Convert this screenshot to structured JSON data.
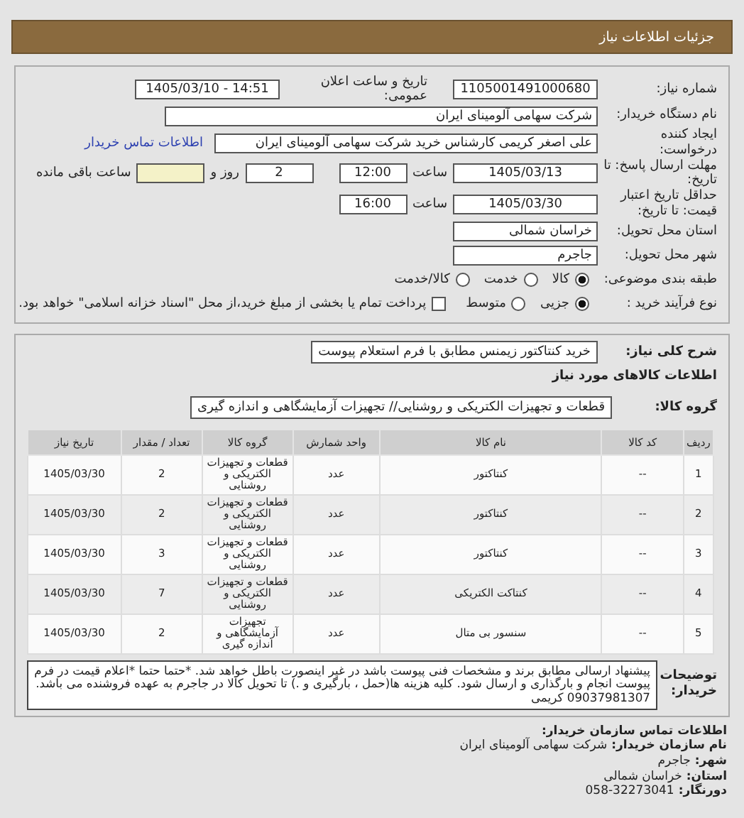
{
  "title": "جزئیات اطلاعات نیاز",
  "need_number": {
    "label": "شماره نیاز:",
    "value": "1105001491000680"
  },
  "announce": {
    "label": "تاریخ و ساعت اعلان عمومی:",
    "value": "1405/03/10 - 14:51"
  },
  "buyer_org": {
    "label": "نام دستگاه خریدار:",
    "value": "شرکت سهامی آلومینای ایران"
  },
  "creator": {
    "label": "ایجاد کننده درخواست:",
    "value": "علی اصغر کریمی کارشناس خرید شرکت سهامی آلومینای ایران",
    "link": "اطلاعات تماس خریدار"
  },
  "deadline": {
    "label": "مهلت ارسال پاسخ: تا تاریخ:",
    "date": "1405/03/13",
    "time_label": "ساعت",
    "time": "12:00",
    "days": "2",
    "days_label": "روز و",
    "remaining_label": "ساعت باقی مانده"
  },
  "validity": {
    "label": "حداقل تاریخ اعتبار قیمت: تا تاریخ:",
    "date": "1405/03/30",
    "time_label": "ساعت",
    "time": "16:00"
  },
  "province": {
    "label": "استان محل تحویل:",
    "value": "خراسان شمالی"
  },
  "city": {
    "label": "شهر محل تحویل:",
    "value": "جاجرم"
  },
  "category": {
    "label": "طبقه بندی موضوعی:",
    "options": [
      {
        "label": "کالا",
        "selected": true
      },
      {
        "label": "خدمت",
        "selected": false
      },
      {
        "label": "کالا/خدمت",
        "selected": false
      }
    ]
  },
  "process": {
    "label": "نوع فرآیند خرید :",
    "options": [
      {
        "label": "جزیی",
        "selected": true
      },
      {
        "label": "متوسط",
        "selected": false
      }
    ],
    "payment": {
      "checked": false,
      "label": "پرداخت تمام یا بخشی از مبلغ خرید،از محل \"اسناد خزانه اسلامی\" خواهد بود."
    }
  },
  "description": {
    "label": "شرح کلی نیاز:",
    "value": "خرید کنتاکتور زیمنس مطابق با فرم استعلام پیوست"
  },
  "goods_heading": "اطلاعات کالاهای مورد نیاز",
  "goods_group": {
    "label": "گروه کالا:",
    "value": "قطعات و تجهیزات الکتریکی و روشنایی// تجهیزات آزمایشگاهی و اندازه گیری"
  },
  "table": {
    "columns": [
      "ردیف",
      "کد کالا",
      "نام کالا",
      "واحد شمارش",
      "گروه کالا",
      "تعداد / مقدار",
      "تاریخ نیاز"
    ],
    "rows": [
      [
        "1",
        "--",
        "کنتاکتور",
        "عدد",
        "قطعات و تجهیزات الکتریکی و روشنایی",
        "2",
        "1405/03/30"
      ],
      [
        "2",
        "--",
        "کنتاکتور",
        "عدد",
        "قطعات و تجهیزات الکتریکی و روشنایی",
        "2",
        "1405/03/30"
      ],
      [
        "3",
        "--",
        "کنتاکتور",
        "عدد",
        "قطعات و تجهیزات الکتریکی و روشنایی",
        "3",
        "1405/03/30"
      ],
      [
        "4",
        "--",
        "کنتاکت الکتریکی",
        "عدد",
        "قطعات و تجهیزات الکتریکی و روشنایی",
        "7",
        "1405/03/30"
      ],
      [
        "5",
        "--",
        "سنسور بی متال",
        "عدد",
        "تجهیزات آزمایشگاهی و اندازه گیری",
        "2",
        "1405/03/30"
      ]
    ]
  },
  "buyer_notes": {
    "label": "توضیحات خریدار:",
    "value": "پیشنهاد ارسالی مطابق برند و مشخصات فنی پیوست باشد در غیر اینصورت باطل خواهد شد. *حتما حتما *اعلام قیمت در فرم پیوست انجام و بارگذاری و ارسال شود. کلیه هزینه ها(حمل ، بارگیری و .) تا تحویل کالا در جاجرم به عهده فروشنده می باشد. 09037981307 کریمی"
  },
  "contact": {
    "heading": "اطلاعات تماس سازمان خریدار:",
    "items": [
      {
        "label": "نام سازمان خریدار:",
        "value": "شرکت سهامی آلومینای ایران"
      },
      {
        "label": "شهر:",
        "value": "جاجرم"
      },
      {
        "label": "استان:",
        "value": "خراسان شمالی"
      },
      {
        "label": "دورنگار:",
        "value": "058-32273041"
      }
    ]
  }
}
